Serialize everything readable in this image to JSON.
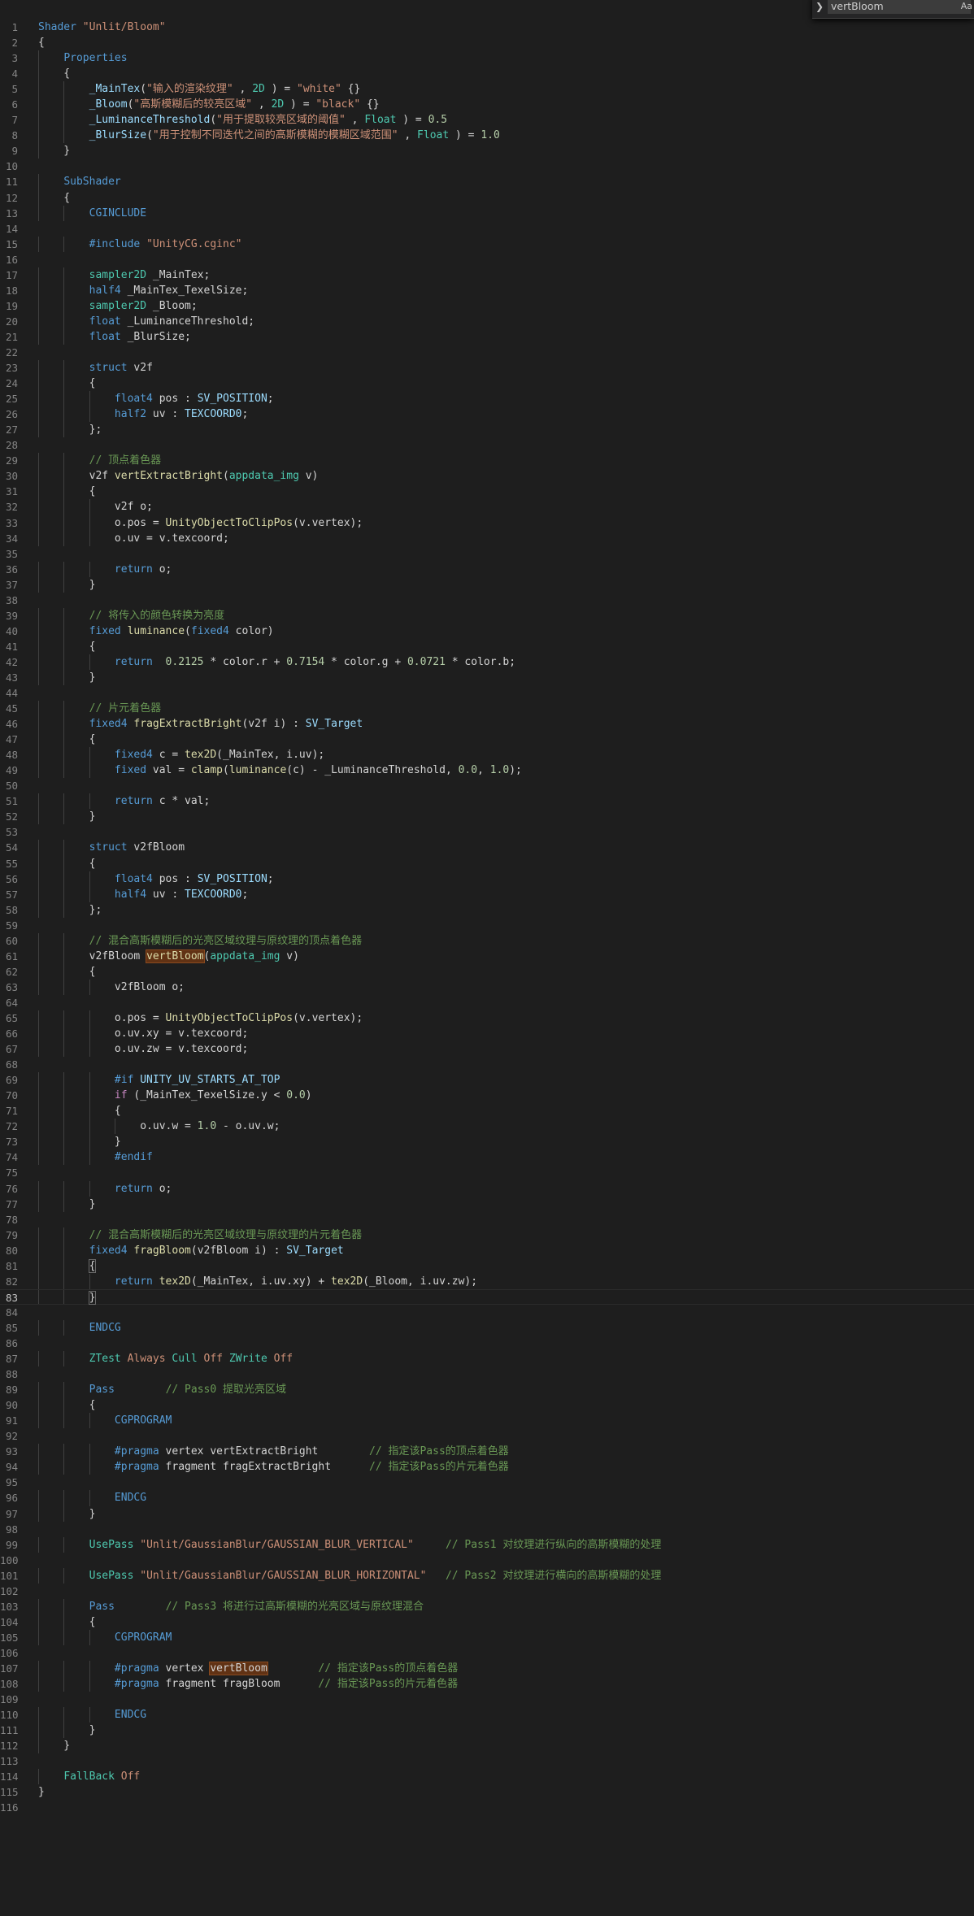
{
  "find_widget": {
    "toggle_icon": "chevron-right-icon",
    "query": "vertBloom",
    "match_case_label": "Aa"
  },
  "editor": {
    "lines": [
      [
        [
          "kw",
          "Shader"
        ],
        [
          "",
          " "
        ],
        [
          "st",
          "\"Unlit/Bloom\""
        ]
      ],
      [
        [
          "",
          "{"
        ]
      ],
      [
        [
          "",
          "    "
        ],
        [
          "kw",
          "Properties"
        ]
      ],
      [
        [
          "",
          "    {"
        ]
      ],
      [
        [
          "",
          "        "
        ],
        [
          "va",
          "_MainTex"
        ],
        [
          "",
          "("
        ],
        [
          "st",
          "\"输入的渲染纹理\""
        ],
        [
          "",
          " , "
        ],
        [
          "ty",
          "2D"
        ],
        [
          "",
          " ) = "
        ],
        [
          "st",
          "\"white\""
        ],
        [
          "",
          " {}"
        ]
      ],
      [
        [
          "",
          "        "
        ],
        [
          "va",
          "_Bloom"
        ],
        [
          "",
          "("
        ],
        [
          "st",
          "\"高斯模糊后的较亮区域\""
        ],
        [
          "",
          " , "
        ],
        [
          "ty",
          "2D"
        ],
        [
          "",
          " ) = "
        ],
        [
          "st",
          "\"black\""
        ],
        [
          "",
          " {}"
        ]
      ],
      [
        [
          "",
          "        "
        ],
        [
          "va",
          "_LuminanceThreshold"
        ],
        [
          "",
          "("
        ],
        [
          "st",
          "\"用于提取较亮区域的阈值\""
        ],
        [
          "",
          " , "
        ],
        [
          "ty",
          "Float"
        ],
        [
          "",
          " ) = "
        ],
        [
          "nu",
          "0.5"
        ]
      ],
      [
        [
          "",
          "        "
        ],
        [
          "va",
          "_BlurSize"
        ],
        [
          "",
          "("
        ],
        [
          "st",
          "\"用于控制不同迭代之间的高斯模糊的模糊区域范围\""
        ],
        [
          "",
          " , "
        ],
        [
          "ty",
          "Float"
        ],
        [
          "",
          " ) = "
        ],
        [
          "nu",
          "1.0"
        ]
      ],
      [
        [
          "",
          "    }"
        ]
      ],
      [
        [
          "",
          ""
        ]
      ],
      [
        [
          "",
          "    "
        ],
        [
          "kw",
          "SubShader"
        ]
      ],
      [
        [
          "",
          "    {"
        ]
      ],
      [
        [
          "",
          "        "
        ],
        [
          "kw",
          "CGINCLUDE"
        ]
      ],
      [
        [
          "",
          ""
        ]
      ],
      [
        [
          "",
          "        "
        ],
        [
          "kw",
          "#include"
        ],
        [
          "",
          " "
        ],
        [
          "st",
          "\"UnityCG.cginc\""
        ]
      ],
      [
        [
          "",
          ""
        ]
      ],
      [
        [
          "",
          "        "
        ],
        [
          "ty",
          "sampler2D"
        ],
        [
          "",
          " _MainTex;"
        ]
      ],
      [
        [
          "",
          "        "
        ],
        [
          "kw",
          "half4"
        ],
        [
          "",
          " _MainTex_TexelSize;"
        ]
      ],
      [
        [
          "",
          "        "
        ],
        [
          "ty",
          "sampler2D"
        ],
        [
          "",
          " _Bloom;"
        ]
      ],
      [
        [
          "",
          "        "
        ],
        [
          "kw",
          "float"
        ],
        [
          "",
          " _LuminanceThreshold;"
        ]
      ],
      [
        [
          "",
          "        "
        ],
        [
          "kw",
          "float"
        ],
        [
          "",
          " _BlurSize;"
        ]
      ],
      [
        [
          "",
          ""
        ]
      ],
      [
        [
          "",
          "        "
        ],
        [
          "kw",
          "struct"
        ],
        [
          "",
          " v2f"
        ]
      ],
      [
        [
          "",
          "        {"
        ]
      ],
      [
        [
          "",
          "            "
        ],
        [
          "kw",
          "float4"
        ],
        [
          "",
          " pos : "
        ],
        [
          "va",
          "SV_POSITION"
        ],
        [
          "",
          ";"
        ]
      ],
      [
        [
          "",
          "            "
        ],
        [
          "kw",
          "half2"
        ],
        [
          "",
          " uv : "
        ],
        [
          "va",
          "TEXCOORD0"
        ],
        [
          "",
          ";"
        ]
      ],
      [
        [
          "",
          "        };"
        ]
      ],
      [
        [
          "",
          ""
        ]
      ],
      [
        [
          "",
          "        "
        ],
        [
          "cm",
          "// 顶点着色器"
        ]
      ],
      [
        [
          "",
          "        v2f "
        ],
        [
          "fn",
          "vertExtractBright"
        ],
        [
          "",
          "("
        ],
        [
          "ty",
          "appdata_img"
        ],
        [
          "",
          " v)"
        ]
      ],
      [
        [
          "",
          "        {"
        ]
      ],
      [
        [
          "",
          "            v2f o;"
        ]
      ],
      [
        [
          "",
          "            o.pos = "
        ],
        [
          "fn",
          "UnityObjectToClipPos"
        ],
        [
          "",
          "(v.vertex);"
        ]
      ],
      [
        [
          "",
          "            o.uv = v.texcoord;"
        ]
      ],
      [
        [
          "",
          ""
        ]
      ],
      [
        [
          "",
          "            "
        ],
        [
          "kw",
          "return"
        ],
        [
          "",
          " o;"
        ]
      ],
      [
        [
          "",
          "        }"
        ]
      ],
      [
        [
          "",
          ""
        ]
      ],
      [
        [
          "",
          "        "
        ],
        [
          "cm",
          "// 将传入的颜色转换为亮度"
        ]
      ],
      [
        [
          "",
          "        "
        ],
        [
          "kw",
          "fixed"
        ],
        [
          "",
          " "
        ],
        [
          "fn",
          "luminance"
        ],
        [
          "",
          "("
        ],
        [
          "kw",
          "fixed4"
        ],
        [
          "",
          " color)"
        ]
      ],
      [
        [
          "",
          "        {"
        ]
      ],
      [
        [
          "",
          "            "
        ],
        [
          "kw",
          "return"
        ],
        [
          "",
          "  "
        ],
        [
          "nu",
          "0.2125"
        ],
        [
          "",
          " * color.r + "
        ],
        [
          "nu",
          "0.7154"
        ],
        [
          "",
          " * color.g + "
        ],
        [
          "nu",
          "0.0721"
        ],
        [
          "",
          " * color.b;"
        ]
      ],
      [
        [
          "",
          "        }"
        ]
      ],
      [
        [
          "",
          ""
        ]
      ],
      [
        [
          "",
          "        "
        ],
        [
          "cm",
          "// 片元着色器"
        ]
      ],
      [
        [
          "",
          "        "
        ],
        [
          "kw",
          "fixed4"
        ],
        [
          "",
          " "
        ],
        [
          "fn",
          "fragExtractBright"
        ],
        [
          "",
          "(v2f i) : "
        ],
        [
          "va",
          "SV_Target"
        ]
      ],
      [
        [
          "",
          "        {"
        ]
      ],
      [
        [
          "",
          "            "
        ],
        [
          "kw",
          "fixed4"
        ],
        [
          "",
          " c = "
        ],
        [
          "fn",
          "tex2D"
        ],
        [
          "",
          "(_MainTex, i.uv);"
        ]
      ],
      [
        [
          "",
          "            "
        ],
        [
          "kw",
          "fixed"
        ],
        [
          "",
          " val = "
        ],
        [
          "fn",
          "clamp"
        ],
        [
          "",
          "("
        ],
        [
          "fn",
          "luminance"
        ],
        [
          "",
          "(c) - _LuminanceThreshold, "
        ],
        [
          "nu",
          "0.0"
        ],
        [
          "",
          ", "
        ],
        [
          "nu",
          "1.0"
        ],
        [
          "",
          ");"
        ]
      ],
      [
        [
          "",
          ""
        ]
      ],
      [
        [
          "",
          "            "
        ],
        [
          "kw",
          "return"
        ],
        [
          "",
          " c * val;"
        ]
      ],
      [
        [
          "",
          "        }"
        ]
      ],
      [
        [
          "",
          ""
        ]
      ],
      [
        [
          "",
          "        "
        ],
        [
          "kw",
          "struct"
        ],
        [
          "",
          " v2fBloom"
        ]
      ],
      [
        [
          "",
          "        {"
        ]
      ],
      [
        [
          "",
          "            "
        ],
        [
          "kw",
          "float4"
        ],
        [
          "",
          " pos : "
        ],
        [
          "va",
          "SV_POSITION"
        ],
        [
          "",
          ";"
        ]
      ],
      [
        [
          "",
          "            "
        ],
        [
          "kw",
          "half4"
        ],
        [
          "",
          " uv : "
        ],
        [
          "va",
          "TEXCOORD0"
        ],
        [
          "",
          ";"
        ]
      ],
      [
        [
          "",
          "        };"
        ]
      ],
      [
        [
          "",
          ""
        ]
      ],
      [
        [
          "",
          "        "
        ],
        [
          "cm",
          "// 混合高斯模糊后的光亮区域纹理与原纹理的顶点着色器"
        ]
      ],
      [
        [
          "",
          "        v2fBloom "
        ],
        [
          "fn hl",
          "vertBloom"
        ],
        [
          "",
          "("
        ],
        [
          "ty",
          "appdata_img"
        ],
        [
          "",
          " v)"
        ]
      ],
      [
        [
          "",
          "        {"
        ]
      ],
      [
        [
          "",
          "            v2fBloom o;"
        ]
      ],
      [
        [
          "",
          ""
        ]
      ],
      [
        [
          "",
          "            o.pos = "
        ],
        [
          "fn",
          "UnityObjectToClipPos"
        ],
        [
          "",
          "(v.vertex);"
        ]
      ],
      [
        [
          "",
          "            o.uv.xy = v.texcoord;"
        ]
      ],
      [
        [
          "",
          "            o.uv.zw = v.texcoord;"
        ]
      ],
      [
        [
          "",
          ""
        ]
      ],
      [
        [
          "",
          "            "
        ],
        [
          "kw",
          "#if"
        ],
        [
          "",
          " "
        ],
        [
          "va",
          "UNITY_UV_STARTS_AT_TOP"
        ]
      ],
      [
        [
          "",
          "            "
        ],
        [
          "ct",
          "if"
        ],
        [
          "",
          " (_MainTex_TexelSize.y < "
        ],
        [
          "nu",
          "0.0"
        ],
        [
          "",
          ")"
        ]
      ],
      [
        [
          "",
          "            {"
        ]
      ],
      [
        [
          "",
          "                o.uv.w = "
        ],
        [
          "nu",
          "1.0"
        ],
        [
          "",
          " - o.uv.w;"
        ]
      ],
      [
        [
          "",
          "            }"
        ]
      ],
      [
        [
          "",
          "            "
        ],
        [
          "kw",
          "#endif"
        ]
      ],
      [
        [
          "",
          ""
        ]
      ],
      [
        [
          "",
          "            "
        ],
        [
          "kw",
          "return"
        ],
        [
          "",
          " o;"
        ]
      ],
      [
        [
          "",
          "        }"
        ]
      ],
      [
        [
          "",
          ""
        ]
      ],
      [
        [
          "",
          "        "
        ],
        [
          "cm",
          "// 混合高斯模糊后的光亮区域纹理与原纹理的片元着色器"
        ]
      ],
      [
        [
          "",
          "        "
        ],
        [
          "kw",
          "fixed4"
        ],
        [
          "",
          " "
        ],
        [
          "fn",
          "fragBloom"
        ],
        [
          "",
          "(v2fBloom i) : "
        ],
        [
          "va",
          "SV_Target"
        ]
      ],
      [
        [
          "",
          "        "
        ],
        [
          "br",
          "{"
        ]
      ],
      [
        [
          "",
          "            "
        ],
        [
          "kw",
          "return"
        ],
        [
          "",
          " "
        ],
        [
          "fn",
          "tex2D"
        ],
        [
          "",
          "(_MainTex, i.uv.xy) + "
        ],
        [
          "fn",
          "tex2D"
        ],
        [
          "",
          "(_Bloom, i.uv.zw);"
        ]
      ],
      [
        [
          "",
          "        "
        ],
        [
          "br",
          "}"
        ]
      ],
      [
        [
          "",
          ""
        ]
      ],
      [
        [
          "",
          "        "
        ],
        [
          "kw",
          "ENDCG"
        ]
      ],
      [
        [
          "",
          ""
        ]
      ],
      [
        [
          "",
          "        "
        ],
        [
          "ty",
          "ZTest"
        ],
        [
          "",
          " "
        ],
        [
          "st",
          "Always"
        ],
        [
          "",
          " "
        ],
        [
          "ty",
          "Cull"
        ],
        [
          "",
          " "
        ],
        [
          "st",
          "Off"
        ],
        [
          "",
          " "
        ],
        [
          "ty",
          "ZWrite"
        ],
        [
          "",
          " "
        ],
        [
          "st",
          "Off"
        ]
      ],
      [
        [
          "",
          ""
        ]
      ],
      [
        [
          "",
          "        "
        ],
        [
          "kw",
          "Pass"
        ],
        [
          "",
          "        "
        ],
        [
          "cm",
          "// Pass0 提取光亮区域"
        ]
      ],
      [
        [
          "",
          "        {"
        ]
      ],
      [
        [
          "",
          "            "
        ],
        [
          "kw",
          "CGPROGRAM"
        ]
      ],
      [
        [
          "",
          ""
        ]
      ],
      [
        [
          "",
          "            "
        ],
        [
          "kw",
          "#pragma"
        ],
        [
          "",
          " vertex vertExtractBright        "
        ],
        [
          "cm",
          "// 指定该Pass的顶点着色器"
        ]
      ],
      [
        [
          "",
          "            "
        ],
        [
          "kw",
          "#pragma"
        ],
        [
          "",
          " fragment fragExtractBright      "
        ],
        [
          "cm",
          "// 指定该Pass的片元着色器"
        ]
      ],
      [
        [
          "",
          ""
        ]
      ],
      [
        [
          "",
          "            "
        ],
        [
          "kw",
          "ENDCG"
        ]
      ],
      [
        [
          "",
          "        }"
        ]
      ],
      [
        [
          "",
          ""
        ]
      ],
      [
        [
          "",
          "        "
        ],
        [
          "ty",
          "UsePass"
        ],
        [
          "",
          " "
        ],
        [
          "st",
          "\"Unlit/GaussianBlur/GAUSSIAN_BLUR_VERTICAL\""
        ],
        [
          "",
          "     "
        ],
        [
          "cm",
          "// Pass1 对纹理进行纵向的高斯模糊的处理"
        ]
      ],
      [
        [
          "",
          ""
        ]
      ],
      [
        [
          "",
          "        "
        ],
        [
          "ty",
          "UsePass"
        ],
        [
          "",
          " "
        ],
        [
          "st",
          "\"Unlit/GaussianBlur/GAUSSIAN_BLUR_HORIZONTAL\""
        ],
        [
          "",
          "   "
        ],
        [
          "cm",
          "// Pass2 对纹理进行横向的高斯模糊的处理"
        ]
      ],
      [
        [
          "",
          ""
        ]
      ],
      [
        [
          "",
          "        "
        ],
        [
          "kw",
          "Pass"
        ],
        [
          "",
          "        "
        ],
        [
          "cm",
          "// Pass3 将进行过高斯模糊的光亮区域与原纹理混合"
        ]
      ],
      [
        [
          "",
          "        {"
        ]
      ],
      [
        [
          "",
          "            "
        ],
        [
          "kw",
          "CGPROGRAM"
        ]
      ],
      [
        [
          "",
          ""
        ]
      ],
      [
        [
          "",
          "            "
        ],
        [
          "kw",
          "#pragma"
        ],
        [
          "",
          " vertex "
        ],
        [
          "hl",
          "vertBloom"
        ],
        [
          "",
          "        "
        ],
        [
          "cm",
          "// 指定该Pass的顶点着色器"
        ]
      ],
      [
        [
          "",
          "            "
        ],
        [
          "kw",
          "#pragma"
        ],
        [
          "",
          " fragment fragBloom      "
        ],
        [
          "cm",
          "// 指定该Pass的片元着色器"
        ]
      ],
      [
        [
          "",
          ""
        ]
      ],
      [
        [
          "",
          "            "
        ],
        [
          "kw",
          "ENDCG"
        ]
      ],
      [
        [
          "",
          "        }"
        ]
      ],
      [
        [
          "",
          "    }"
        ]
      ],
      [
        [
          "",
          ""
        ]
      ],
      [
        [
          "",
          "    "
        ],
        [
          "ty",
          "FallBack"
        ],
        [
          "",
          " "
        ],
        [
          "st",
          "Off"
        ]
      ],
      [
        [
          "",
          "}"
        ]
      ],
      [
        [
          "",
          ""
        ]
      ]
    ]
  }
}
